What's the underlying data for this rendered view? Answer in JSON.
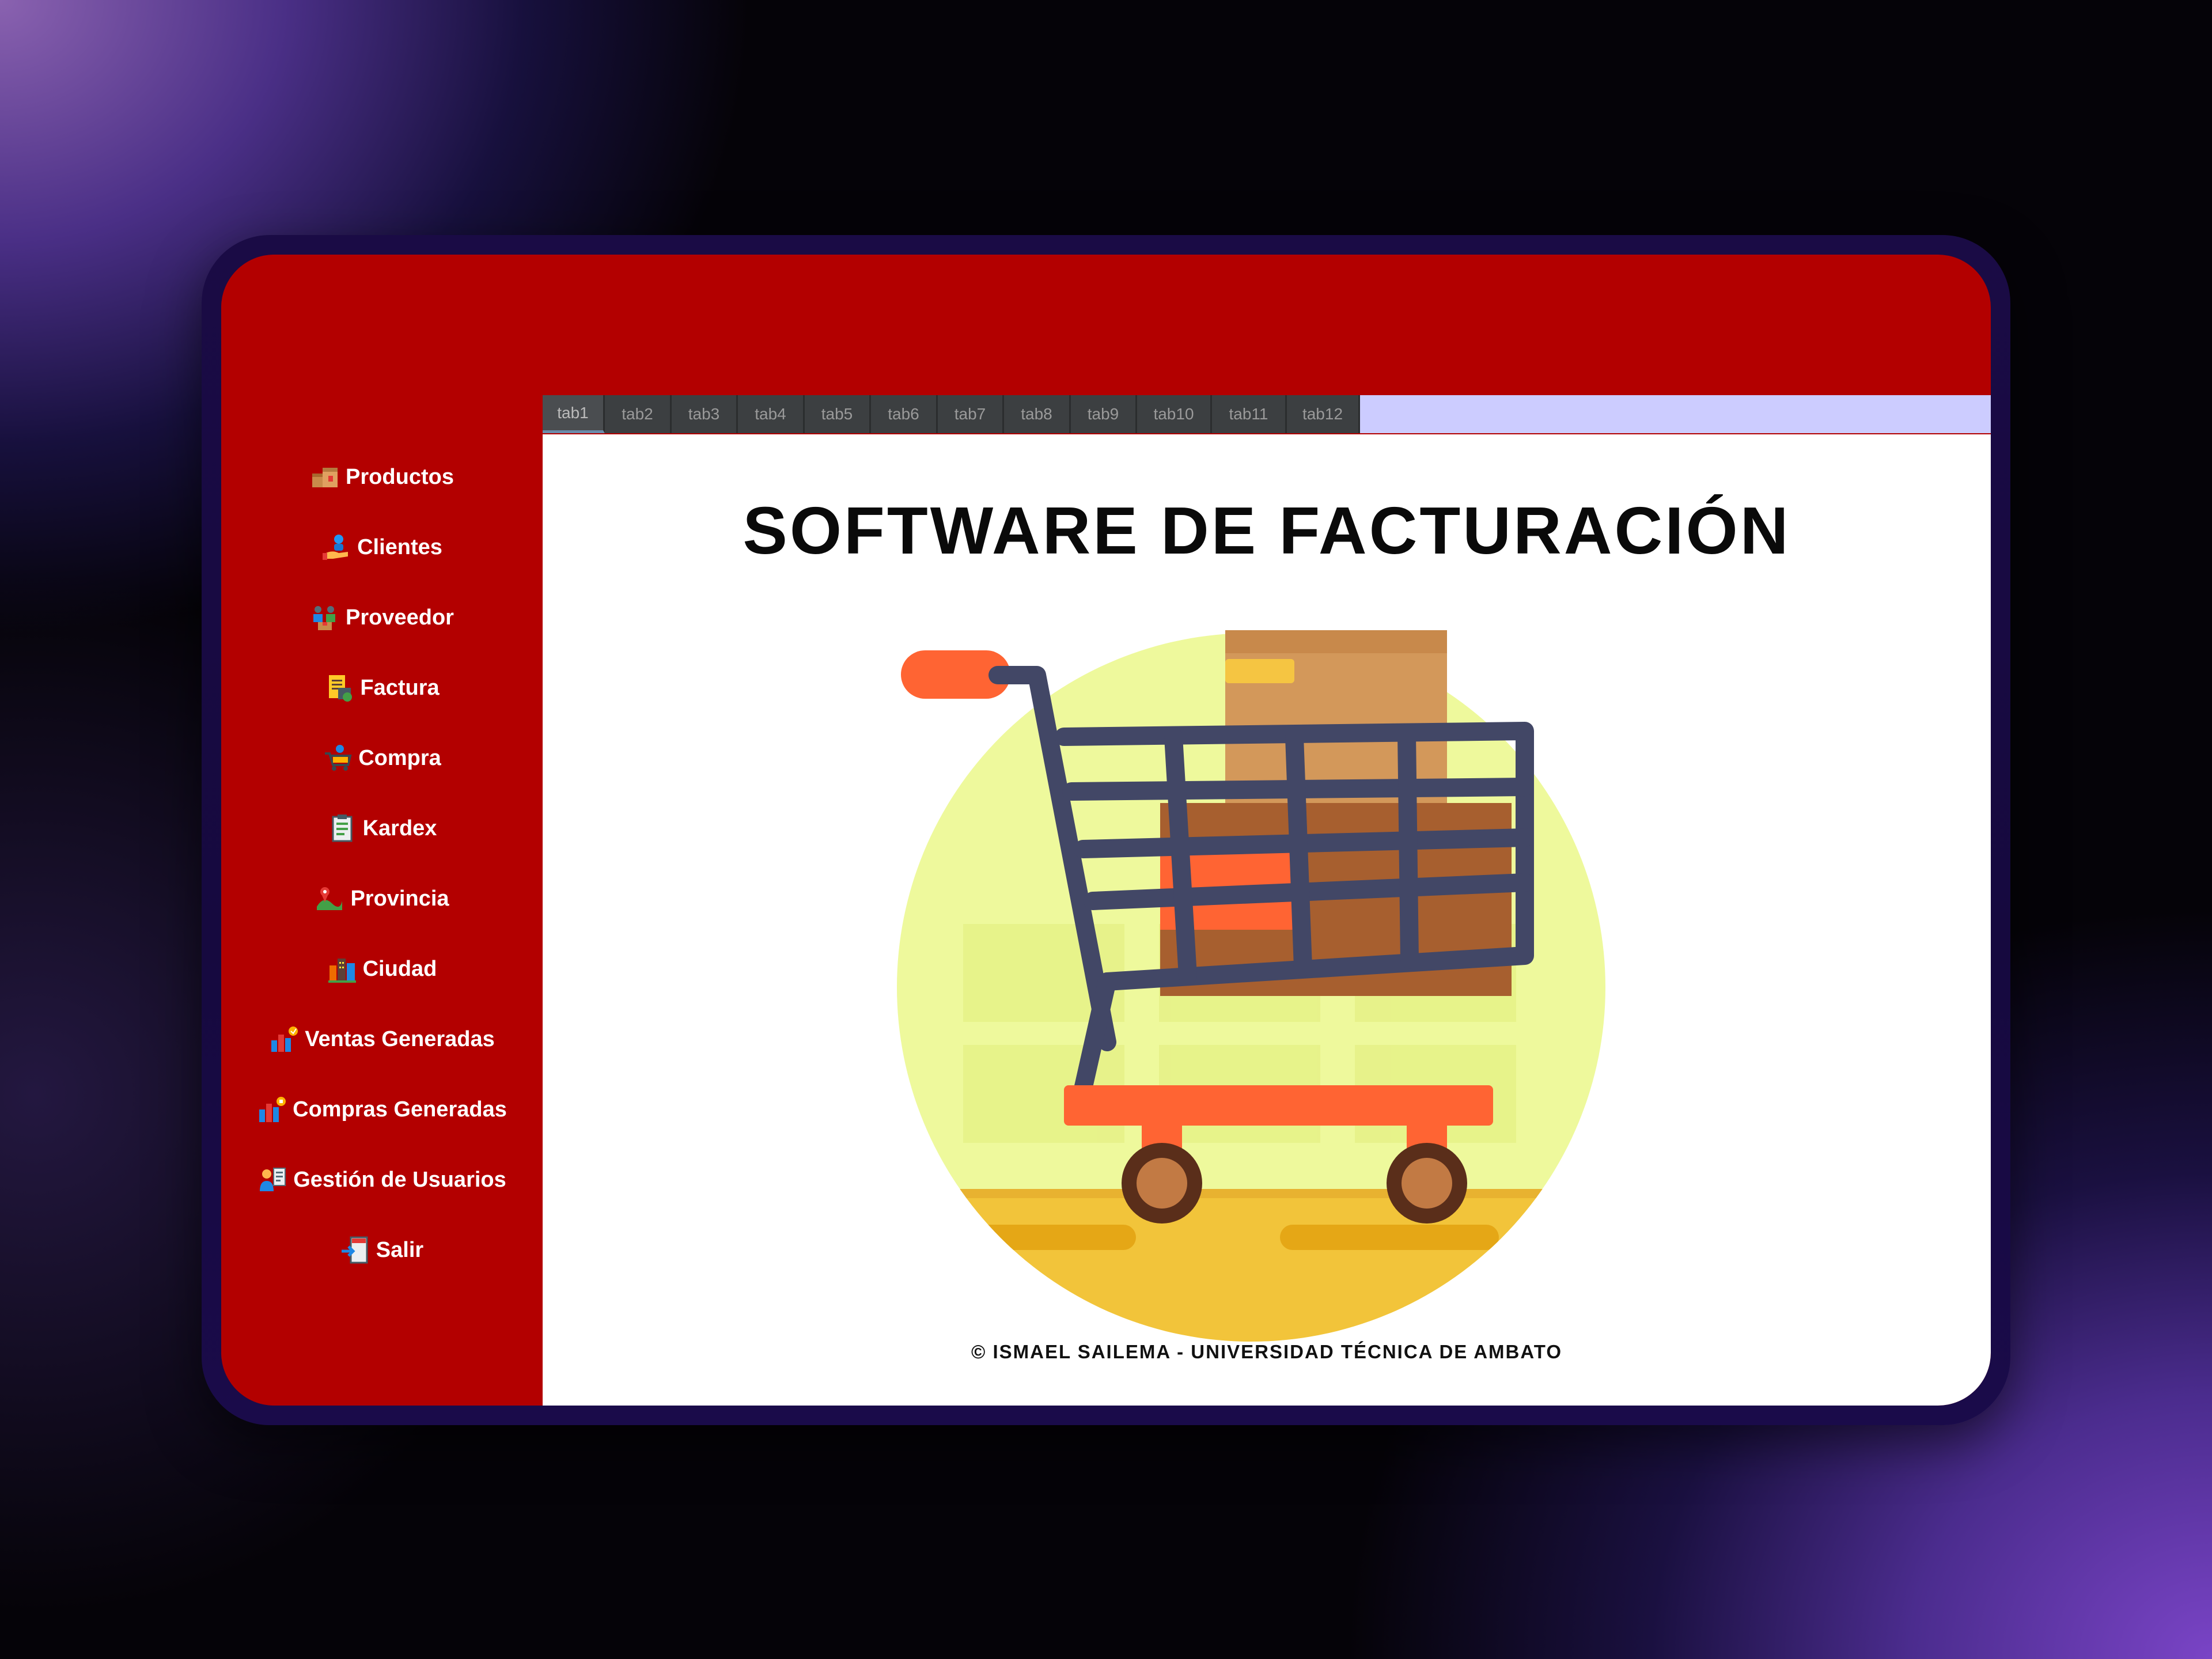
{
  "sidebar": {
    "items": [
      {
        "label": "Productos",
        "icon": "boxes-icon"
      },
      {
        "label": "Clientes",
        "icon": "client-hand-icon"
      },
      {
        "label": "Proveedor",
        "icon": "supplier-icon"
      },
      {
        "label": "Factura",
        "icon": "invoice-icon"
      },
      {
        "label": "Compra",
        "icon": "cart-icon"
      },
      {
        "label": "Kardex",
        "icon": "clipboard-icon"
      },
      {
        "label": "Provincia",
        "icon": "map-pin-icon"
      },
      {
        "label": "Ciudad",
        "icon": "city-icon"
      },
      {
        "label": "Ventas Generadas",
        "icon": "sales-report-icon"
      },
      {
        "label": "Compras Generadas",
        "icon": "purchases-report-icon"
      },
      {
        "label": "Gestión de Usuarios",
        "icon": "user-management-icon"
      },
      {
        "label": "Salir",
        "icon": "exit-icon"
      }
    ]
  },
  "tabs": [
    "tab1",
    "tab2",
    "tab3",
    "tab4",
    "tab5",
    "tab6",
    "tab7",
    "tab8",
    "tab9",
    "tab10",
    "tab11",
    "tab12"
  ],
  "main": {
    "title": "SOFTWARE DE FACTURACIÓN",
    "illustration": "shopping-cart-icon",
    "footer": "© ISMAEL SAILEMA - UNIVERSIDAD TÉCNICA DE AMBATO"
  },
  "colors": {
    "accent_red": "#b30000",
    "tab_strip": "#ccccff",
    "tab_bg": "#3c3f41",
    "cart_frame": "#424766",
    "cart_orange": "#ff6433",
    "circle_yellow": "#eef99c"
  }
}
